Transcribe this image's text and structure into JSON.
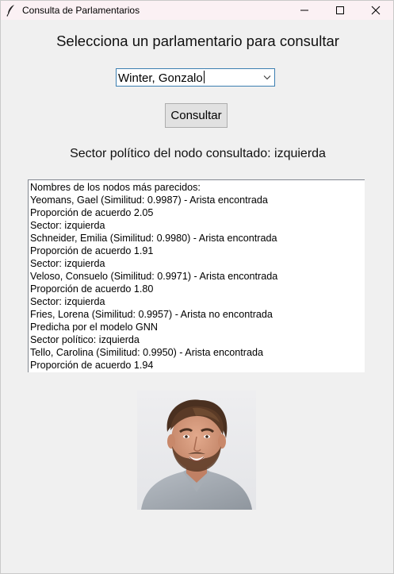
{
  "window": {
    "title": "Consulta de Parlamentarios",
    "minimize_icon": "minimize-icon",
    "maximize_icon": "maximize-icon",
    "close_icon": "close-icon",
    "app_icon": "feather-icon"
  },
  "main": {
    "heading": "Selecciona un parlamentario para consultar",
    "selector": {
      "value": "Winter, Gonzalo",
      "arrow_icon": "chevron-down-icon"
    },
    "consult_button": "Consultar",
    "sector_label": "Sector político del nodo consultado: izquierda",
    "results_lines": [
      "Nombres de los nodos más parecidos:",
      "Yeomans, Gael (Similitud: 0.9987) - Arista encontrada",
      "Proporción de acuerdo 2.05",
      "Sector: izquierda",
      "Schneider, Emilia (Similitud: 0.9980) - Arista encontrada",
      "Proporción de acuerdo 1.91",
      "Sector: izquierda",
      "Veloso, Consuelo (Similitud: 0.9971) - Arista encontrada",
      "Proporción de acuerdo 1.80",
      "Sector: izquierda",
      "Fries, Lorena (Similitud: 0.9957) - Arista no encontrada",
      "Predicha por el modelo GNN",
      "Sector político: izquierda",
      "Tello, Carolina (Similitud: 0.9950) - Arista encontrada",
      "Proporción de acuerdo 1.94"
    ],
    "photo": "portrait of a man with beard in grey shirt"
  },
  "colors": {
    "titlebar": "#fbf1f4",
    "background": "#f0f0f0",
    "combo_border": "#3c7fb1"
  }
}
